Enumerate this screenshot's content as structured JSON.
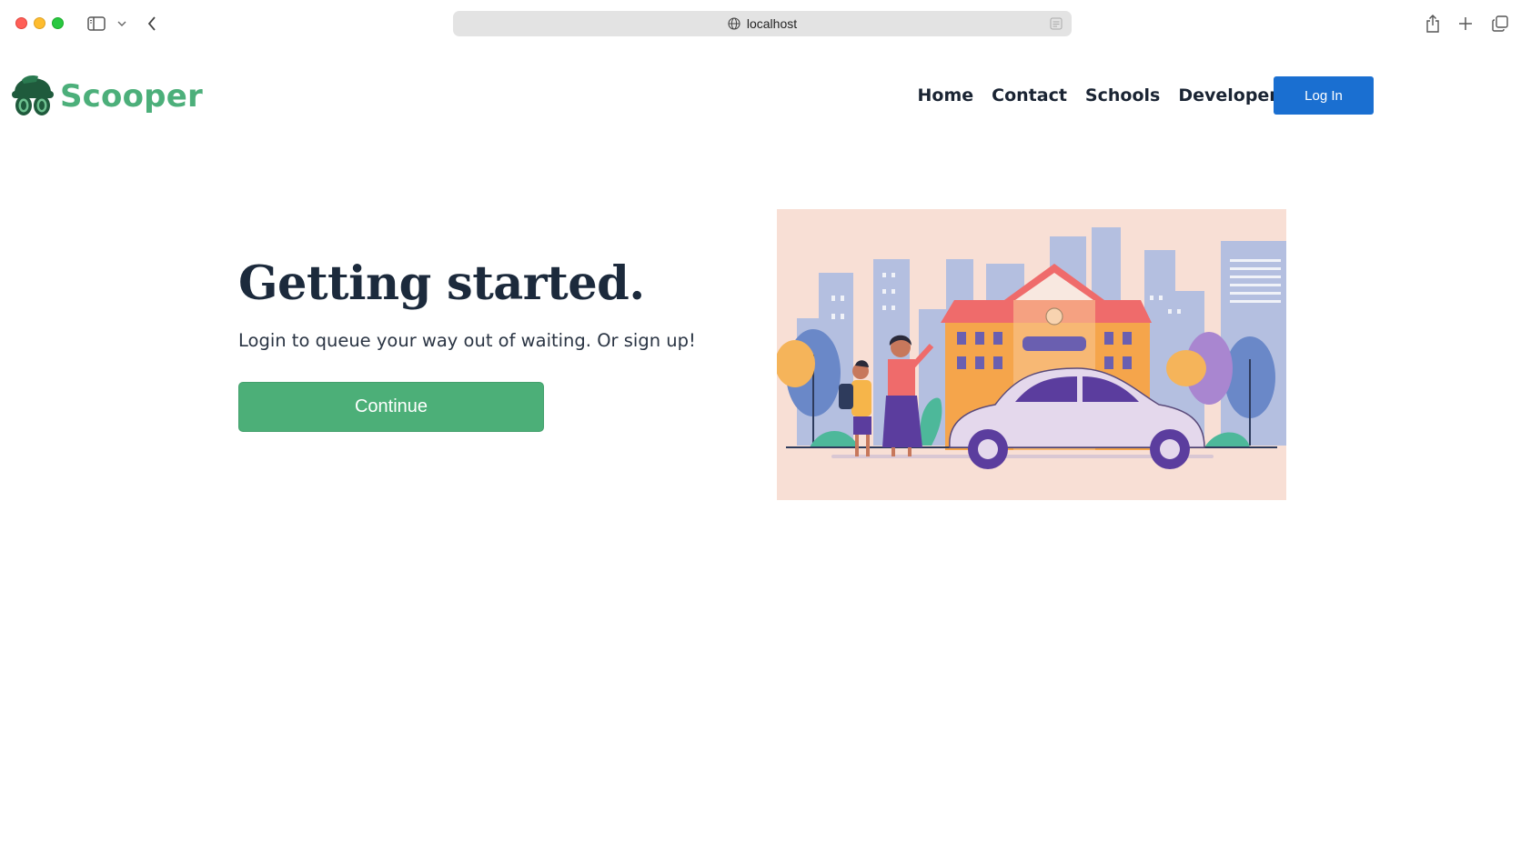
{
  "browser": {
    "url": "localhost"
  },
  "site": {
    "brand": "Scooper",
    "nav": {
      "home": "Home",
      "contact": "Contact",
      "schools": "Schools",
      "developers": "Developers",
      "login": "Log In"
    }
  },
  "hero": {
    "title": "Getting started.",
    "subtitle": "Login to queue your way out of waiting. Or sign up!",
    "button": "Continue"
  },
  "colors": {
    "brand_green": "#4caf7a",
    "login_blue": "#1a6fd1",
    "continue_green": "#4caf78",
    "illustration_bg": "#f8dfd5"
  },
  "icons": {
    "logo": "green-car-logo-icon",
    "sidebar": "sidebar-icon",
    "back": "chevron-left-icon",
    "globe": "globe-icon",
    "reader": "reader-icon",
    "share": "share-icon",
    "new_tab": "plus-icon",
    "tabs": "tabs-overview-icon"
  }
}
